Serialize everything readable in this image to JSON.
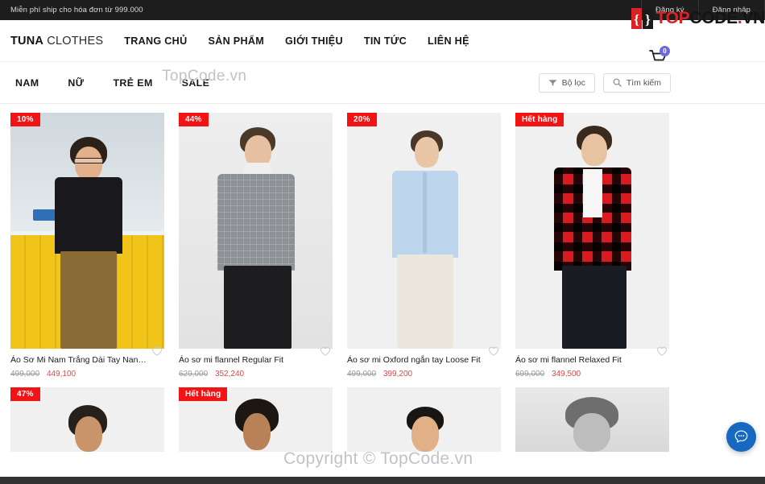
{
  "topbar": {
    "message": "Miễn phí ship cho hóa đơn từ 999.000",
    "links": [
      {
        "label": "Đăng ký"
      },
      {
        "label": "Đăng nhập"
      }
    ]
  },
  "header": {
    "brand_bold": "TUNA",
    "brand_light": " CLOTHES",
    "nav": [
      {
        "label": "TRANG CHỦ"
      },
      {
        "label": "SẢN PHẨM"
      },
      {
        "label": "GIỚI THIỆU"
      },
      {
        "label": "TIN TỨC"
      },
      {
        "label": "LIÊN HỆ"
      }
    ],
    "cart": {
      "icon": "cart-icon",
      "count": "0",
      "badge_color": "#6a6ae0"
    }
  },
  "category_bar": {
    "categories": [
      {
        "label": "NAM"
      },
      {
        "label": "NỮ"
      },
      {
        "label": "TRẺ EM"
      },
      {
        "label": "SALE"
      }
    ],
    "filter_button": {
      "label": "Bộ lọc",
      "icon": "filter-icon"
    },
    "search_button": {
      "label": "Tìm kiếm",
      "icon": "search-icon"
    }
  },
  "products": [
    {
      "title": "Áo Sơ Mi Nam Trắng Dài Tay Nano Kh...",
      "badge": "10%",
      "badge_type": "discount",
      "price_old": "499,000",
      "price_new": "449,100",
      "scene": "station",
      "favorite_icon": "heart-icon"
    },
    {
      "title": "Áo sơ mi flannel Regular Fit",
      "badge": "44%",
      "badge_type": "discount",
      "price_old": "629,000",
      "price_new": "352,240",
      "scene": "grey-flannel",
      "favorite_icon": "heart-icon"
    },
    {
      "title": "Áo sơ mi Oxford ngắn tay Loose Fit",
      "badge": "20%",
      "badge_type": "discount",
      "price_old": "499,000",
      "price_new": "399,200",
      "scene": "blue-oxford",
      "favorite_icon": "heart-icon"
    },
    {
      "title": "Áo sơ mi flannel Relaxed Fit",
      "badge": "Hết hàng",
      "badge_type": "soldout",
      "price_old": "699,000",
      "price_new": "349,500",
      "scene": "red-plaid",
      "favorite_icon": "heart-icon"
    }
  ],
  "products_row2": [
    {
      "badge": "47%",
      "badge_type": "discount",
      "scene": "dark-curly"
    },
    {
      "badge": "Hết hàng",
      "badge_type": "soldout",
      "scene": "black-shirt"
    },
    {
      "badge": "",
      "badge_type": "none",
      "scene": "green-shirt"
    },
    {
      "badge": "",
      "badge_type": "none",
      "scene": "bw-portrait"
    }
  ],
  "watermarks": {
    "top_center": "TopCode.vn",
    "bottom_center": "Copyright © TopCode.vn",
    "logo_red": "TOP",
    "logo_dark": "CODE",
    "logo_dot_red": ".",
    "logo_vn": "VN"
  },
  "chat_widget": {
    "icon": "chat-bubble-icon",
    "color": "#1668c1"
  }
}
